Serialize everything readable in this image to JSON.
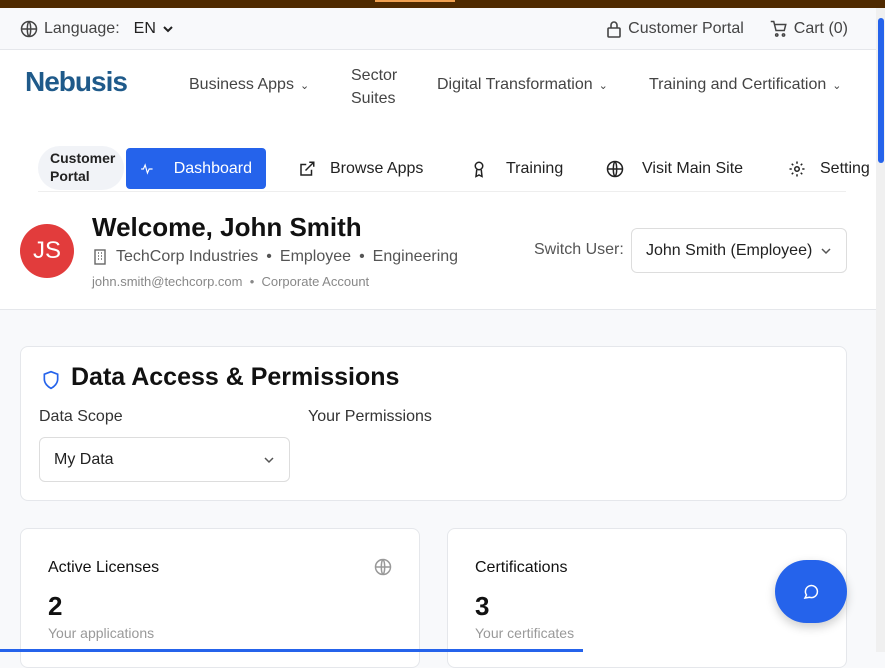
{
  "util": {
    "language_label": "Language:",
    "language_value": "EN",
    "portal": "Customer Portal",
    "cart": "Cart (0)"
  },
  "nav": {
    "logo": "Nebusis",
    "items": [
      "Business Apps",
      "Sector Suites",
      "Digital Transformation",
      "Training and Certification"
    ]
  },
  "tabs": {
    "portal": "Customer Portal",
    "dashboard": "Dashboard",
    "browse": "Browse Apps",
    "training": "Training",
    "visit": "Visit Main Site",
    "settings": "Setting"
  },
  "user": {
    "initials": "JS",
    "welcome": "Welcome, John Smith",
    "company": "TechCorp Industries",
    "role": "Employee",
    "dept": "Engineering",
    "email": "john.smith@techcorp.com",
    "account": "Corporate Account",
    "switch_label": "Switch User:",
    "switch_value": "John Smith (Employee)"
  },
  "perm": {
    "title": "Data Access & Permissions",
    "scope_label": "Data Scope",
    "scope_value": "My Data",
    "permissions_label": "Your Permissions"
  },
  "stats": [
    {
      "label": "Active Licenses",
      "value": "2",
      "sub": "Your applications"
    },
    {
      "label": "Certifications",
      "value": "3",
      "sub": "Your certificates"
    }
  ],
  "colors": {
    "accent": "#2563eb",
    "avatar": "#e23c3c",
    "logo": "#1f5a8a"
  }
}
